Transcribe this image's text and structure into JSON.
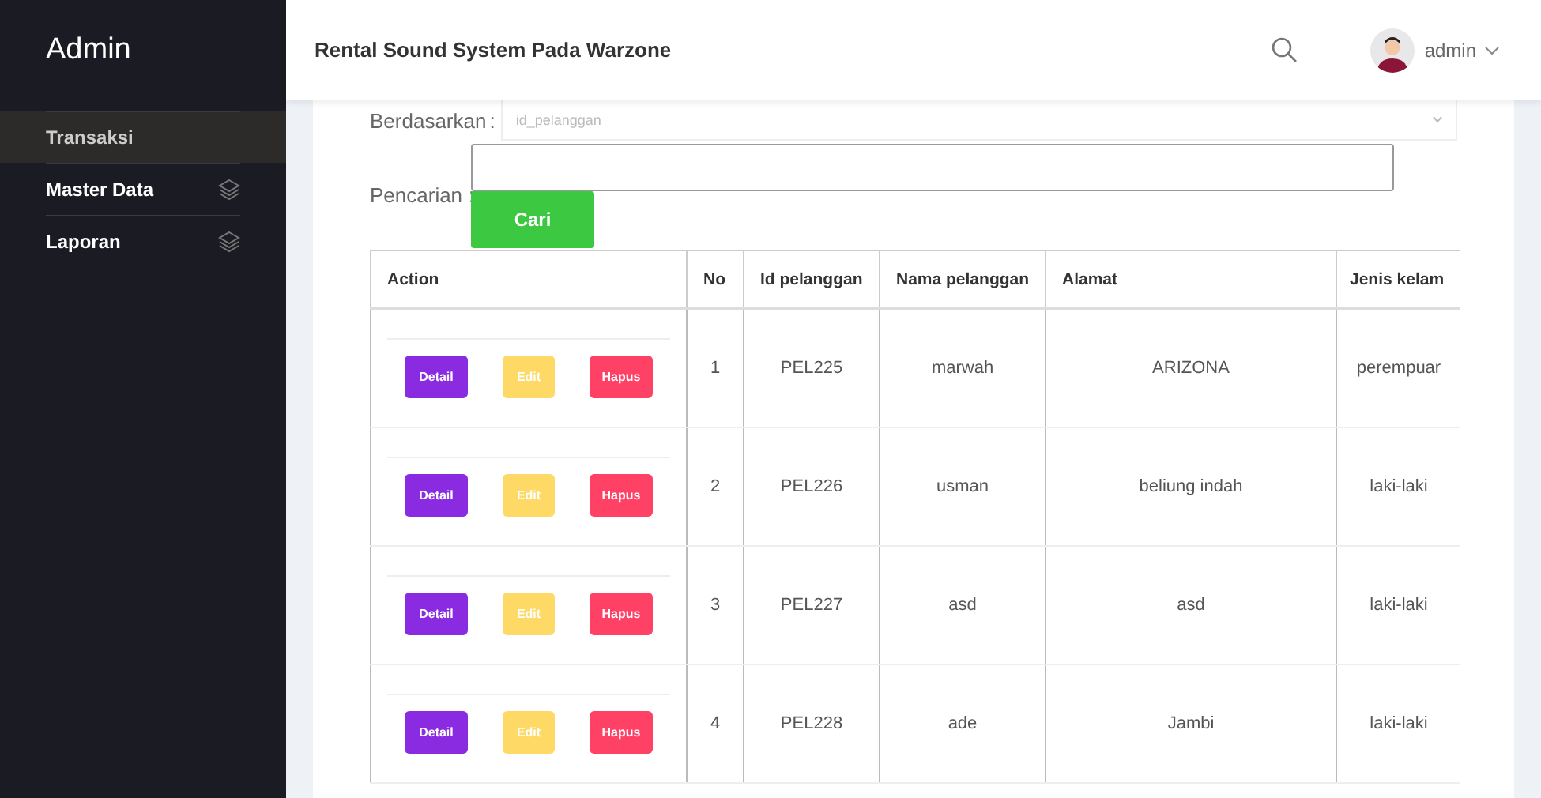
{
  "sidebar": {
    "brand": "Admin",
    "items": [
      {
        "label": "Transaksi",
        "selected": true,
        "has_icon": false
      },
      {
        "label": "Master Data",
        "selected": false,
        "has_icon": true
      },
      {
        "label": "Laporan",
        "selected": false,
        "has_icon": true
      }
    ]
  },
  "topbar": {
    "title": "Rental Sound System Pada Warzone",
    "user": "admin"
  },
  "filter": {
    "label": "Berdasarkan",
    "separator": ":",
    "value": "id_pelanggan"
  },
  "search": {
    "label": "Pencarian",
    "separator": ":",
    "button": "Cari"
  },
  "table": {
    "columns": [
      "Action",
      "No",
      "Id pelanggan",
      "Nama pelanggan",
      "Alamat",
      "Jenis kelam"
    ],
    "rows": [
      {
        "cells": [
          {
            "kind": "actions",
            "buttons": [
              "Detail",
              "Edit",
              "Hapus"
            ]
          },
          {
            "kind": "text",
            "text": "1"
          },
          {
            "kind": "text",
            "text": "PEL225"
          },
          {
            "kind": "text",
            "text": "marwah"
          },
          {
            "kind": "text",
            "text": "ARIZONA"
          },
          {
            "kind": "text",
            "text": "perempuar"
          }
        ]
      },
      {
        "cells": [
          {
            "kind": "actions",
            "buttons": [
              "Detail",
              "Edit",
              "Hapus"
            ]
          },
          {
            "kind": "text",
            "text": "2"
          },
          {
            "kind": "text",
            "text": "PEL226"
          },
          {
            "kind": "text",
            "text": "usman"
          },
          {
            "kind": "text",
            "text": "beliung indah"
          },
          {
            "kind": "text",
            "text": "laki-laki"
          }
        ]
      },
      {
        "cells": [
          {
            "kind": "actions",
            "buttons": [
              "Detail",
              "Edit",
              "Hapus"
            ]
          },
          {
            "kind": "text",
            "text": "3"
          },
          {
            "kind": "text",
            "text": "PEL227"
          },
          {
            "kind": "text",
            "text": "asd"
          },
          {
            "kind": "text",
            "text": "asd"
          },
          {
            "kind": "text",
            "text": "laki-laki"
          }
        ]
      },
      {
        "cells": [
          {
            "kind": "actions",
            "buttons": [
              "Detail",
              "Edit",
              "Hapus"
            ]
          },
          {
            "kind": "text",
            "text": "4"
          },
          {
            "kind": "text",
            "text": "PEL228"
          },
          {
            "kind": "text",
            "text": "ade"
          },
          {
            "kind": "text",
            "text": "Jambi"
          },
          {
            "kind": "text",
            "text": "laki-laki"
          }
        ]
      }
    ]
  }
}
